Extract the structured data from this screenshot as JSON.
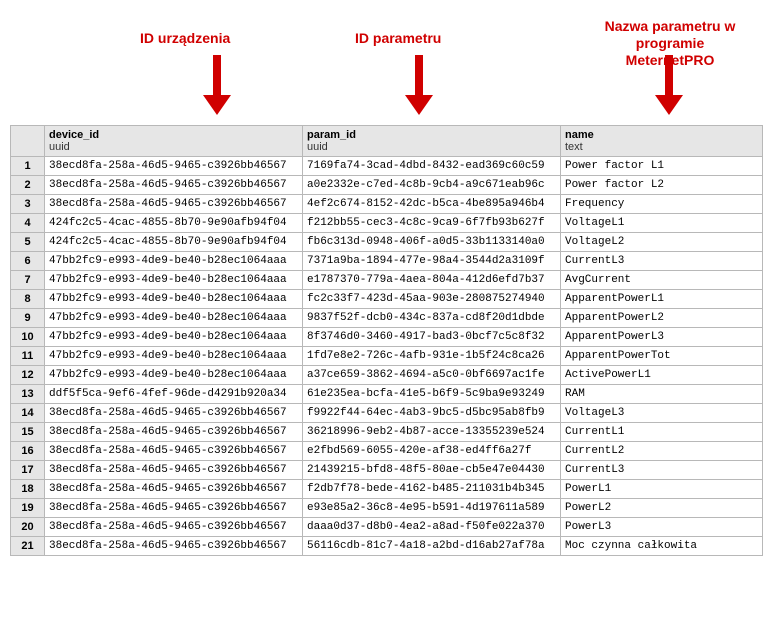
{
  "annotations": {
    "device": "ID urządzenia",
    "param": "ID parametru",
    "name": "Nazwa parametru w programie MeternetPRO"
  },
  "columns": {
    "device_id": {
      "title": "device_id",
      "subtitle": "uuid"
    },
    "param_id": {
      "title": "param_id",
      "subtitle": "uuid"
    },
    "name": {
      "title": "name",
      "subtitle": "text"
    }
  },
  "rows": [
    {
      "n": "1",
      "device_id": "38ecd8fa-258a-46d5-9465-c3926bb46567",
      "param_id": "7169fa74-3cad-4dbd-8432-ead369c60c59",
      "name": "Power factor L1"
    },
    {
      "n": "2",
      "device_id": "38ecd8fa-258a-46d5-9465-c3926bb46567",
      "param_id": "a0e2332e-c7ed-4c8b-9cb4-a9c671eab96c",
      "name": "Power factor L2"
    },
    {
      "n": "3",
      "device_id": "38ecd8fa-258a-46d5-9465-c3926bb46567",
      "param_id": "4ef2c674-8152-42dc-b5ca-4be895a946b4",
      "name": "Frequency"
    },
    {
      "n": "4",
      "device_id": "424fc2c5-4cac-4855-8b70-9e90afb94f04",
      "param_id": "f212bb55-cec3-4c8c-9ca9-6f7fb93b627f",
      "name": "VoltageL1"
    },
    {
      "n": "5",
      "device_id": "424fc2c5-4cac-4855-8b70-9e90afb94f04",
      "param_id": "fb6c313d-0948-406f-a0d5-33b1133140a0",
      "name": "VoltageL2"
    },
    {
      "n": "6",
      "device_id": "47bb2fc9-e993-4de9-be40-b28ec1064aaa",
      "param_id": "7371a9ba-1894-477e-98a4-3544d2a3109f",
      "name": "CurrentL3"
    },
    {
      "n": "7",
      "device_id": "47bb2fc9-e993-4de9-be40-b28ec1064aaa",
      "param_id": "e1787370-779a-4aea-804a-412d6efd7b37",
      "name": "AvgCurrent"
    },
    {
      "n": "8",
      "device_id": "47bb2fc9-e993-4de9-be40-b28ec1064aaa",
      "param_id": "fc2c33f7-423d-45aa-903e-280875274940",
      "name": "ApparentPowerL1"
    },
    {
      "n": "9",
      "device_id": "47bb2fc9-e993-4de9-be40-b28ec1064aaa",
      "param_id": "9837f52f-dcb0-434c-837a-cd8f20d1dbde",
      "name": "ApparentPowerL2"
    },
    {
      "n": "10",
      "device_id": "47bb2fc9-e993-4de9-be40-b28ec1064aaa",
      "param_id": "8f3746d0-3460-4917-bad3-0bcf7c5c8f32",
      "name": "ApparentPowerL3"
    },
    {
      "n": "11",
      "device_id": "47bb2fc9-e993-4de9-be40-b28ec1064aaa",
      "param_id": "1fd7e8e2-726c-4afb-931e-1b5f24c8ca26",
      "name": "ApparentPowerTot"
    },
    {
      "n": "12",
      "device_id": "47bb2fc9-e993-4de9-be40-b28ec1064aaa",
      "param_id": "a37ce659-3862-4694-a5c0-0bf6697ac1fe",
      "name": "ActivePowerL1"
    },
    {
      "n": "13",
      "device_id": "ddf5f5ca-9ef6-4fef-96de-d4291b920a34",
      "param_id": "61e235ea-bcfa-41e5-b6f9-5c9ba9e93249",
      "name": "RAM"
    },
    {
      "n": "14",
      "device_id": "38ecd8fa-258a-46d5-9465-c3926bb46567",
      "param_id": "f9922f44-64ec-4ab3-9bc5-d5bc95ab8fb9",
      "name": "VoltageL3"
    },
    {
      "n": "15",
      "device_id": "38ecd8fa-258a-46d5-9465-c3926bb46567",
      "param_id": "36218996-9eb2-4b87-acce-13355239e524",
      "name": "CurrentL1"
    },
    {
      "n": "16",
      "device_id": "38ecd8fa-258a-46d5-9465-c3926bb46567",
      "param_id": "e2fbd569-6055-420e-af38-ed4ff6a27f",
      "name": "CurrentL2"
    },
    {
      "n": "17",
      "device_id": "38ecd8fa-258a-46d5-9465-c3926bb46567",
      "param_id": "21439215-bfd8-48f5-80ae-cb5e47e04430",
      "name": "CurrentL3"
    },
    {
      "n": "18",
      "device_id": "38ecd8fa-258a-46d5-9465-c3926bb46567",
      "param_id": "f2db7f78-bede-4162-b485-211031b4b345",
      "name": "PowerL1"
    },
    {
      "n": "19",
      "device_id": "38ecd8fa-258a-46d5-9465-c3926bb46567",
      "param_id": "e93e85a2-36c8-4e95-b591-4d197611a589",
      "name": "PowerL2"
    },
    {
      "n": "20",
      "device_id": "38ecd8fa-258a-46d5-9465-c3926bb46567",
      "param_id": "daaa0d37-d8b0-4ea2-a8ad-f50fe022a370",
      "name": "PowerL3"
    },
    {
      "n": "21",
      "device_id": "38ecd8fa-258a-46d5-9465-c3926bb46567",
      "param_id": "56116cdb-81c7-4a18-a2bd-d16ab27af78a",
      "name": "Moc czynna całkowita"
    }
  ]
}
